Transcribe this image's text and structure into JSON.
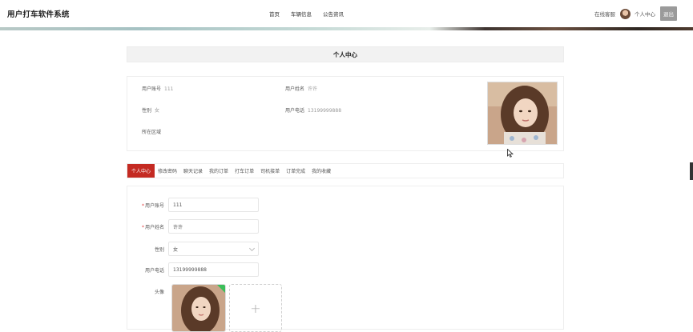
{
  "header": {
    "brand": "用户打车软件系统",
    "nav": [
      "首页",
      "车辆信息",
      "公告资讯"
    ],
    "online_service": "在线客服",
    "user_center": "个人中心",
    "logout": "退出"
  },
  "page_title": "个人中心",
  "info": {
    "account_label": "用户账号",
    "account_value": "111",
    "name_label": "用户姓名",
    "name_value": "许许",
    "gender_label": "性别",
    "gender_value": "女",
    "phone_label": "用户电话",
    "phone_value": "13199999888",
    "region_label": "所在区域",
    "region_value": ""
  },
  "tabs": [
    "个人中心",
    "修改密码",
    "聊天记录",
    "我的订单",
    "打车订单",
    "司机接单",
    "订单完成",
    "我的收藏"
  ],
  "form": {
    "account_label": "用户账号",
    "account_value": "111",
    "name_label": "用户姓名",
    "name_value": "许许",
    "gender_label": "性别",
    "gender_value": "女",
    "phone_label": "用户电话",
    "phone_value": "13199999888",
    "avatar_label": "头像",
    "upload_plus": "+"
  },
  "colors": {
    "accent": "#c42a22",
    "success": "#3bbf5a"
  }
}
